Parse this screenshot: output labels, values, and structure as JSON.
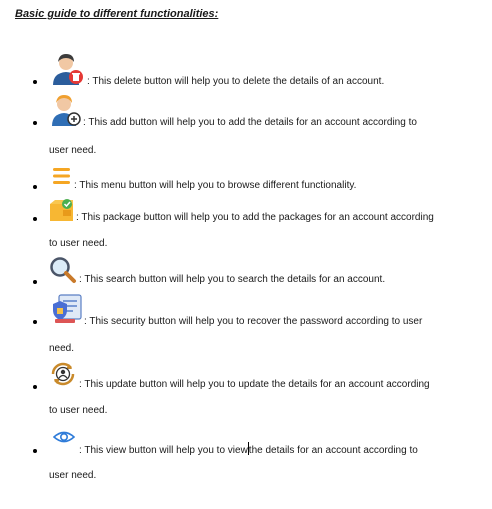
{
  "title": "Basic guide to different functionalities:",
  "items": [
    {
      "icon": "delete-user-icon",
      "text": ": This delete button will help you to delete the details of an account.",
      "cont": ""
    },
    {
      "icon": "add-user-icon",
      "text": ": This add button will help you to add the details for an account according to",
      "cont": "user need."
    },
    {
      "icon": "menu-icon",
      "text": ": This menu button will help you to browse different functionality.",
      "cont": ""
    },
    {
      "icon": "package-icon",
      "text": ": This package button will help you to add the packages for an account according",
      "cont": "to user need."
    },
    {
      "icon": "search-icon",
      "text": ": This search button will help you to search the details for an account.",
      "cont": ""
    },
    {
      "icon": "security-icon",
      "text": ": This security button will help you to recover the password according to user",
      "cont": "need."
    },
    {
      "icon": "update-icon",
      "text": ": This update button will help you to update the details for an account according",
      "cont": "to user need."
    },
    {
      "icon": "view-eye-icon",
      "text_a": ": This view button will help you to view",
      "text_b": "the details for an account according to",
      "cont": "user need."
    }
  ]
}
